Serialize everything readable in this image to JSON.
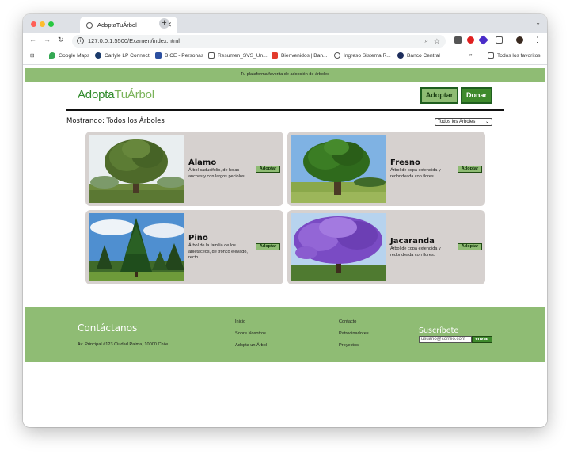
{
  "browser": {
    "tab_title": "AdoptaTuÁrbol",
    "url": "127.0.0.1:5500/Examen/index.html",
    "bookmarks": [
      "Google Maps",
      "Carlyle LP Connect",
      "BICE - Personas",
      "Resumen_SVS_Un...",
      "Bienvenidos | Ban...",
      "Ingreso Sistema R...",
      "Banco Central"
    ],
    "all_bookmarks": "Todos los favoritos",
    "colors": {
      "tabstrip": "#dee1e6",
      "close": "#ff5f57",
      "minimize": "#febc2e",
      "maximize": "#28c840"
    }
  },
  "site": {
    "banner": "Tu plataforma favorita de adopción de árboles",
    "logo_part1": "Adopta",
    "logo_part2": "TuÁrbol",
    "nav": {
      "adoptar": "Adoptar",
      "donar": "Donar"
    },
    "showing": "Mostrando: Todos los Árboles",
    "filter_selected": "Todos los Árboles",
    "colors": {
      "accent": "#8fbc74",
      "dark_green": "#3e8a2c",
      "card": "#d6d1cf"
    }
  },
  "trees": [
    {
      "name": "Álamo",
      "desc": "Árbol caducifolio, de hojas anchas y con largos peciolos.",
      "button": "Adoptar"
    },
    {
      "name": "Fresno",
      "desc": "Árbol de copa extendida y redondeada con flores.",
      "button": "Adoptar"
    },
    {
      "name": "Pino",
      "desc": "Árbol de la familia de los abietáceos, de tronco elevado, recto.",
      "button": "Adoptar"
    },
    {
      "name": "Jacaranda",
      "desc": "Árbol de copa extendida y redondeada con flores.",
      "button": "Adoptar"
    }
  ],
  "footer": {
    "title": "Contáctanos",
    "address": "Av. Principal #123 Ciudad Palma, 10000 Chile",
    "links": [
      "Inicio",
      "Sobre Nosotros",
      "Adopta un Árbol",
      "Contacto",
      "Patrocinadores",
      "Proyectos"
    ],
    "subscribe": "Suscríbete",
    "email_placeholder": "usuario@correo.com",
    "send": "enviar"
  }
}
